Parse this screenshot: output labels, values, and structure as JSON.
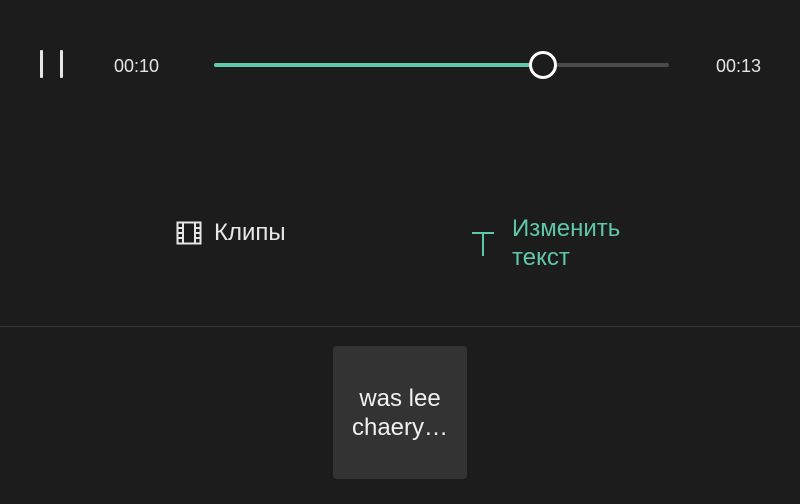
{
  "player": {
    "state": "playing",
    "current_time": "00:10",
    "total_time": "00:13",
    "progress_fraction": 0.72
  },
  "toolbar": {
    "clips_label": "Клипы",
    "edit_text_label_line1": "Изменить",
    "edit_text_label_line2": "текст"
  },
  "clip": {
    "line1": "was lee",
    "line2": "chaery…"
  },
  "colors": {
    "background": "#1c1c1c",
    "accent": "#5fc7ab",
    "track": "#4a4a4a",
    "card": "#333333"
  },
  "icons": {
    "pause": "pause-icon",
    "clips": "film-icon",
    "edit_text": "text-icon"
  }
}
